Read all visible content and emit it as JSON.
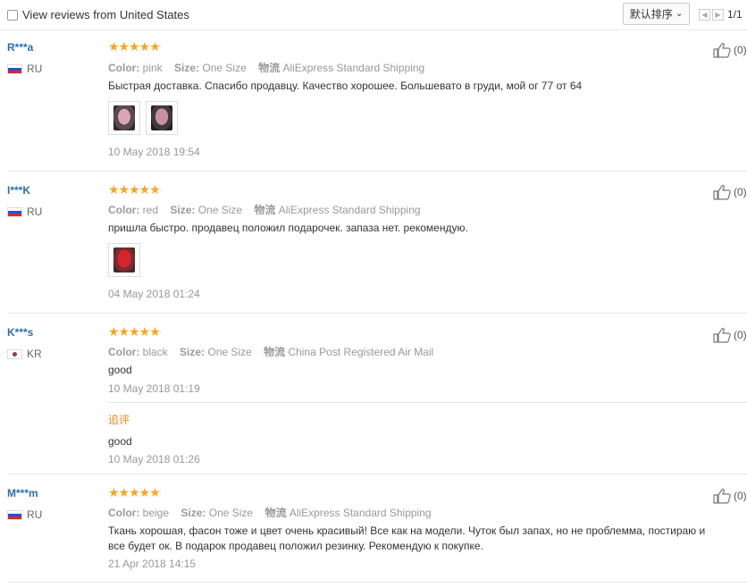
{
  "filter": {
    "label": "View reviews from United States",
    "checked": false
  },
  "sort": {
    "label": "默认排序"
  },
  "pager": {
    "text": "1/1"
  },
  "field_labels": {
    "color": "Color:",
    "size": "Size:",
    "shipping": "物流"
  },
  "accent": {
    "star": "#f6a623",
    "username": "#2b6fb0",
    "followup": "#e6891a"
  },
  "reviews": [
    {
      "user": "R***a",
      "country": "RU",
      "flag": "ru-flag-icon",
      "stars": 5,
      "color": "pink",
      "size": "One Size",
      "shipping": "AliExpress Standard Shipping",
      "text": "Быстрая доставка. Спасибо продавцу. Качество хорошее. Большевато в груди, мой ог 77 от 64",
      "photos": 2,
      "date": "10 May 2018 19:54",
      "likes": "(0)"
    },
    {
      "user": "I***K",
      "country": "RU",
      "flag": "ru-flag-icon",
      "stars": 5,
      "color": "red",
      "size": "One Size",
      "shipping": "AliExpress Standard Shipping",
      "text": "пришла быстро. продавец положил подарочек. запаза нет. рекомендую.",
      "photos": 1,
      "date": "04 May 2018 01:24",
      "likes": "(0)"
    },
    {
      "user": "K***s",
      "country": "KR",
      "flag": "kr-flag-icon",
      "stars": 5,
      "color": "black",
      "size": "One Size",
      "shipping": "China Post Registered Air Mail",
      "text": "good",
      "date": "10 May 2018 01:19",
      "likes": "(0)",
      "followup": {
        "label": "追评",
        "text": "good",
        "date": "10 May 2018 01:26"
      }
    },
    {
      "user": "M***m",
      "country": "RU",
      "flag": "ru-flag-icon",
      "stars": 5,
      "color": "beige",
      "size": "One Size",
      "shipping": "AliExpress Standard Shipping",
      "text_line1": "Ткань хорошая, фасон тоже и цвет очень красивый! Все как на модели. Чуток был запах, но не проблемма, постираю и",
      "text_line2": "все будет ок. В подарок продавец положил резинку. Рекомендую к покупке.",
      "date": "21 Apr 2018 14:15",
      "likes": "(0)"
    }
  ]
}
